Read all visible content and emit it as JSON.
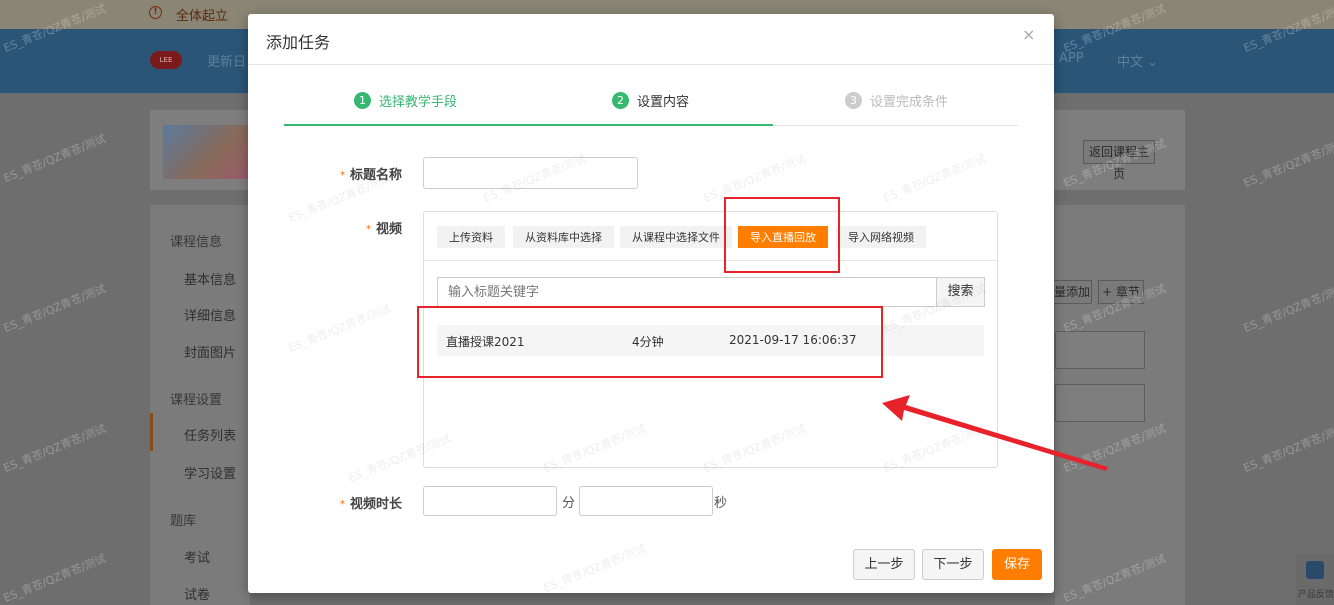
{
  "background": {
    "notice": "全体起立",
    "header_links": [
      "更新日",
      "APP",
      "中文 ⌄"
    ],
    "logo_text": "LEE",
    "back_button": "返回课程主页",
    "sidebar": {
      "section_course_info": "课程信息",
      "basic_info": "基本信息",
      "detail_info": "详细信息",
      "cover_image": "封面图片",
      "section_course_settings": "课程设置",
      "task_list": "任务列表",
      "study_settings": "学习设置",
      "section_question_bank": "题库",
      "exam": "考试",
      "paper": "试卷"
    },
    "main_buttons": [
      "批量添加",
      "+ 章节"
    ],
    "float_label": "产品反馈",
    "watermark": "ES_青苍/QZ青苍/测试"
  },
  "modal": {
    "title": "添加任务",
    "close": "×",
    "steps": [
      {
        "num": "1",
        "label": "选择教学手段"
      },
      {
        "num": "2",
        "label": "设置内容"
      },
      {
        "num": "3",
        "label": "设置完成条件"
      }
    ],
    "form": {
      "required_mark": "*",
      "title_label": "标题名称",
      "title_value": "",
      "video_label": "视频",
      "video_tabs": [
        "上传资料",
        "从资料库中选择",
        "从课程中选择文件",
        "导入直播回放",
        "导入网络视频"
      ],
      "active_tab": "导入直播回放",
      "search_placeholder": "输入标题关键字",
      "search_button": "搜索",
      "results": [
        {
          "name": "直播授课2021",
          "duration": "4分钟",
          "time": "2021-09-17 16:06:37"
        }
      ],
      "duration_label": "视频时长",
      "minutes_value": "",
      "minutes_unit": "分",
      "seconds_value": "",
      "seconds_unit": "秒"
    },
    "footer": {
      "prev": "上一步",
      "next": "下一步",
      "save": "保存"
    }
  },
  "colors": {
    "accent": "#ff7d00",
    "step_done": "#35b870",
    "annotation": "#e8222a"
  }
}
